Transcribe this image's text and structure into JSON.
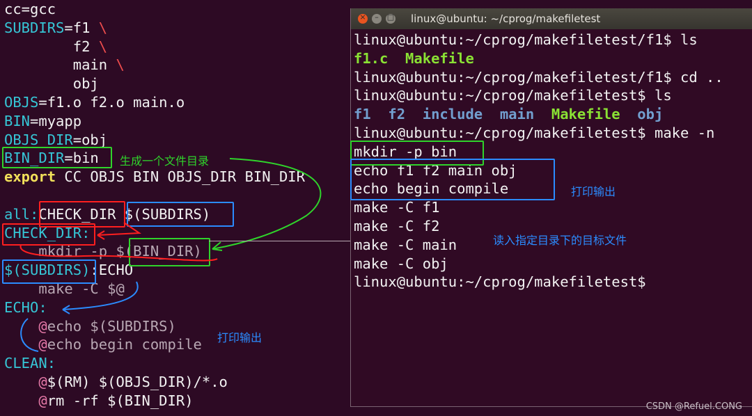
{
  "makefile": {
    "lines": [
      [
        {
          "t": "cc=gcc",
          "c": "white"
        }
      ],
      [
        {
          "t": "SUBDIRS",
          "c": "cyan"
        },
        {
          "t": "=f1 ",
          "c": "white"
        },
        {
          "t": "\\",
          "c": "red"
        }
      ],
      [
        {
          "t": "        f2 ",
          "c": "white"
        },
        {
          "t": "\\",
          "c": "red"
        }
      ],
      [
        {
          "t": "        main ",
          "c": "white"
        },
        {
          "t": "\\",
          "c": "red"
        }
      ],
      [
        {
          "t": "        obj",
          "c": "white"
        }
      ],
      [
        {
          "t": "OBJS",
          "c": "cyan"
        },
        {
          "t": "=f1.o f2.o main.o",
          "c": "white"
        }
      ],
      [
        {
          "t": "BIN",
          "c": "cyan"
        },
        {
          "t": "=myapp",
          "c": "white"
        }
      ],
      [
        {
          "t": "OBJS_DIR",
          "c": "cyan"
        },
        {
          "t": "=obj",
          "c": "white"
        }
      ],
      [
        {
          "t": "BIN_DIR",
          "c": "cyan"
        },
        {
          "t": "=bin",
          "c": "white"
        }
      ],
      [
        {
          "t": "export",
          "c": "yellow"
        },
        {
          "t": " CC OBJS BIN OBJS_DIR BIN_DIR",
          "c": "white"
        }
      ],
      [
        {
          "t": "",
          "c": "white"
        }
      ],
      [
        {
          "t": "all:",
          "c": "cyan"
        },
        {
          "t": "CHECK_DIR $(SUBDIRS)",
          "c": "white"
        }
      ],
      [
        {
          "t": "CHECK_DIR:",
          "c": "cyan"
        }
      ],
      [
        {
          "t": "    mkdir -p $(BIN_DIR)",
          "c": "dim"
        }
      ],
      [
        {
          "t": "$(SUBDIRS)",
          "c": "cyan"
        },
        {
          "t": ":ECHO",
          "c": "white"
        }
      ],
      [
        {
          "t": "    make -C $@",
          "c": "dim"
        }
      ],
      [
        {
          "t": "ECHO:",
          "c": "cyan"
        }
      ],
      [
        {
          "t": "    ",
          "c": "white"
        },
        {
          "t": "@",
          "c": "pink"
        },
        {
          "t": "echo $(SUBDIRS)",
          "c": "dim"
        }
      ],
      [
        {
          "t": "    ",
          "c": "white"
        },
        {
          "t": "@",
          "c": "pink"
        },
        {
          "t": "echo begin compile",
          "c": "dim"
        }
      ],
      [
        {
          "t": "CLEAN:",
          "c": "cyan"
        }
      ],
      [
        {
          "t": "    ",
          "c": "white"
        },
        {
          "t": "@",
          "c": "pink"
        },
        {
          "t": "$(RM) $(OBJS_DIR)/*.o",
          "c": "white"
        }
      ],
      [
        {
          "t": "    ",
          "c": "white"
        },
        {
          "t": "@",
          "c": "pink"
        },
        {
          "t": "rm -rf $(BIN_DIR)",
          "c": "white"
        }
      ]
    ]
  },
  "terminal": {
    "title": "linux@ubuntu: ~/cprog/makefiletest",
    "buttons": {
      "close": "×",
      "minimize": "–",
      "maximize": "□"
    },
    "lines": [
      [
        {
          "t": "linux@ubuntu:~/cprog/makefiletest/f1$ ls",
          "c": "plain"
        }
      ],
      [
        {
          "t": "f1.c  Makefile",
          "c": "green"
        }
      ],
      [
        {
          "t": "linux@ubuntu:~/cprog/makefiletest/f1$ cd ..",
          "c": "plain"
        }
      ],
      [
        {
          "t": "linux@ubuntu:~/cprog/makefiletest$ ls",
          "c": "plain"
        }
      ],
      [
        {
          "t": "f1  f2  include  main  ",
          "c": "blue"
        },
        {
          "t": "Makefile",
          "c": "green"
        },
        {
          "t": "  obj",
          "c": "blue"
        }
      ],
      [
        {
          "t": "linux@ubuntu:~/cprog/makefiletest$ make -n",
          "c": "plain"
        }
      ],
      [
        {
          "t": "mkdir -p bin",
          "c": "plain"
        }
      ],
      [
        {
          "t": "echo f1 f2 main obj",
          "c": "plain"
        }
      ],
      [
        {
          "t": "echo begin compile",
          "c": "plain"
        }
      ],
      [
        {
          "t": "make -C f1",
          "c": "plain"
        }
      ],
      [
        {
          "t": "make -C f2",
          "c": "plain"
        }
      ],
      [
        {
          "t": "make -C main",
          "c": "plain"
        }
      ],
      [
        {
          "t": "make -C obj",
          "c": "plain"
        }
      ],
      [
        {
          "t": "linux@ubuntu:~/cprog/makefiletest$",
          "c": "plain"
        }
      ]
    ]
  },
  "annotations": {
    "generate_dir": "生成一个文件目录",
    "print_output_terminal": "打印输出",
    "read_target": "读入指定目录下的目标文件",
    "print_output_code": "打印输出"
  },
  "colors": {
    "background": "#2d0a24",
    "green_box": "#2fd42b",
    "red_box": "#ff1f1f",
    "blue_box": "#2b8cff"
  },
  "watermark": "CSDN @Refuel.CONG"
}
